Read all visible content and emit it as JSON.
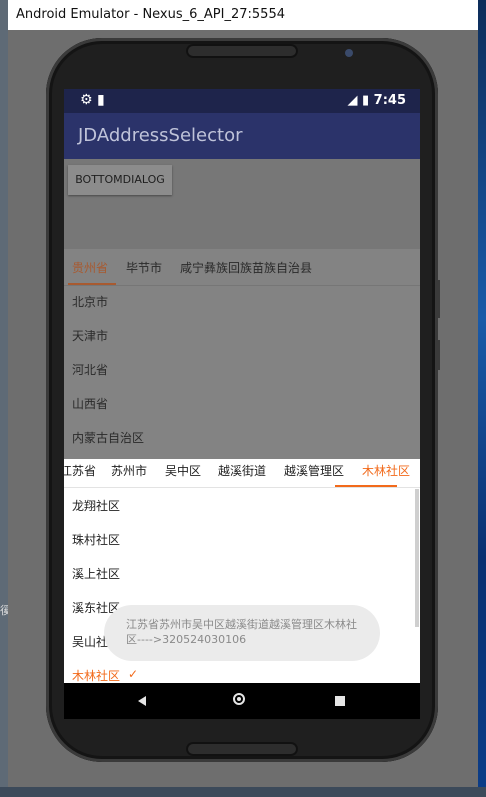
{
  "window": {
    "title": "Android Emulator - Nexus_6_API_27:5554"
  },
  "desktop": {
    "left_glyph": "徯"
  },
  "statusbar": {
    "left_icons": "⚙ ▮",
    "time": "7:45",
    "signal_battery": "◢ ▮"
  },
  "app": {
    "title": "JDAddressSelector",
    "button_label": "BOTTOMDIALOG"
  },
  "sheet1": {
    "tabs": [
      "贵州省",
      "毕节市",
      "咸宁彝族回族苗族自治县"
    ],
    "items": [
      "北京市",
      "天津市",
      "河北省",
      "山西省",
      "内蒙古自治区"
    ]
  },
  "sheet2": {
    "tabs": [
      "江苏省",
      "苏州市",
      "吴中区",
      "越溪街道",
      "越溪管理区",
      "木林社区"
    ],
    "items": [
      "龙翔社区",
      "珠村社区",
      "溪上社区",
      "溪东社区",
      "吴山社区",
      "木林社区"
    ],
    "check": "✓"
  },
  "toast": {
    "text": "江苏省苏州市吴中区越溪街道越溪管理区木林社区---->320524030106"
  },
  "colors": {
    "accent": "#f26a1b",
    "statusbar": "#1e244b",
    "appbar": "#2b336a"
  },
  "icons": [
    "gear-icon",
    "sd-card-icon",
    "signal-icon",
    "battery-icon",
    "back-icon",
    "home-icon",
    "recents-icon",
    "checkmark-icon"
  ]
}
